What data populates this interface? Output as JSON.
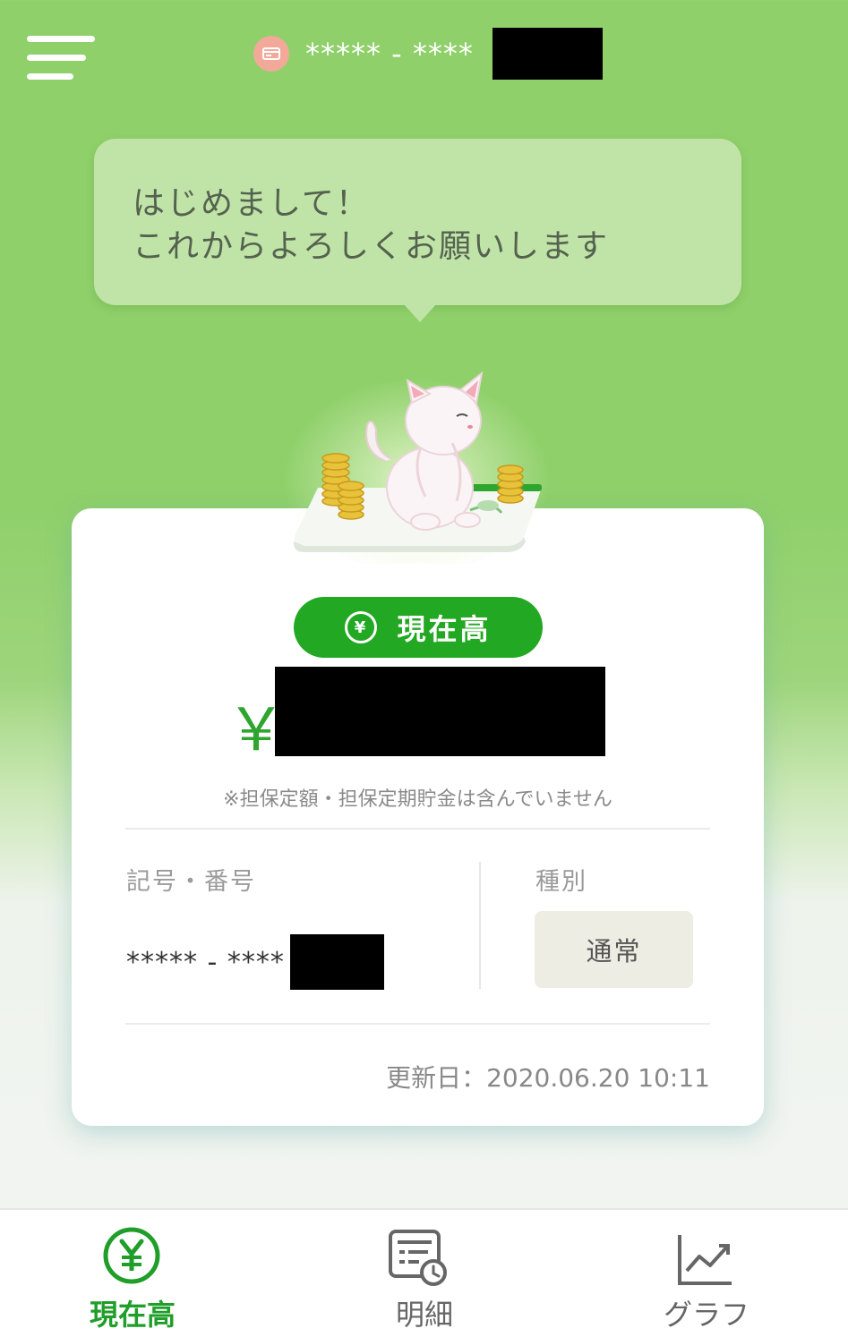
{
  "header": {
    "account_masked": "***** - ****",
    "menu_icon": "hamburger-menu-icon",
    "account_icon": "bankbook-icon"
  },
  "bubble": {
    "line1": "はじめまして！",
    "line2": "これからよろしくお願いします"
  },
  "mascot": {
    "icon": "cat-with-coins-illustration"
  },
  "balance": {
    "pill_label": "現在高",
    "pill_icon": "yen-circle-icon",
    "currency": "￥",
    "note": "※担保定額・担保定期貯金は含んでいません"
  },
  "account": {
    "number_label": "記号・番号",
    "number_masked": "***** - ****",
    "type_label": "種別",
    "type_value": "通常",
    "updated": "更新日：2020.06.20 10:11"
  },
  "nav": {
    "items": [
      {
        "label": "現在高",
        "icon": "yen-circle-icon",
        "active": true
      },
      {
        "label": "明細",
        "icon": "statement-clock-icon",
        "active": false
      },
      {
        "label": "グラフ",
        "icon": "line-chart-icon",
        "active": false
      }
    ]
  },
  "colors": {
    "header_green": "#8fd06a",
    "accent_green": "#22a822",
    "yen_green": "#2ea52e",
    "bubble_bg": "#c0e4a8",
    "chip_bg": "#eeede4"
  }
}
